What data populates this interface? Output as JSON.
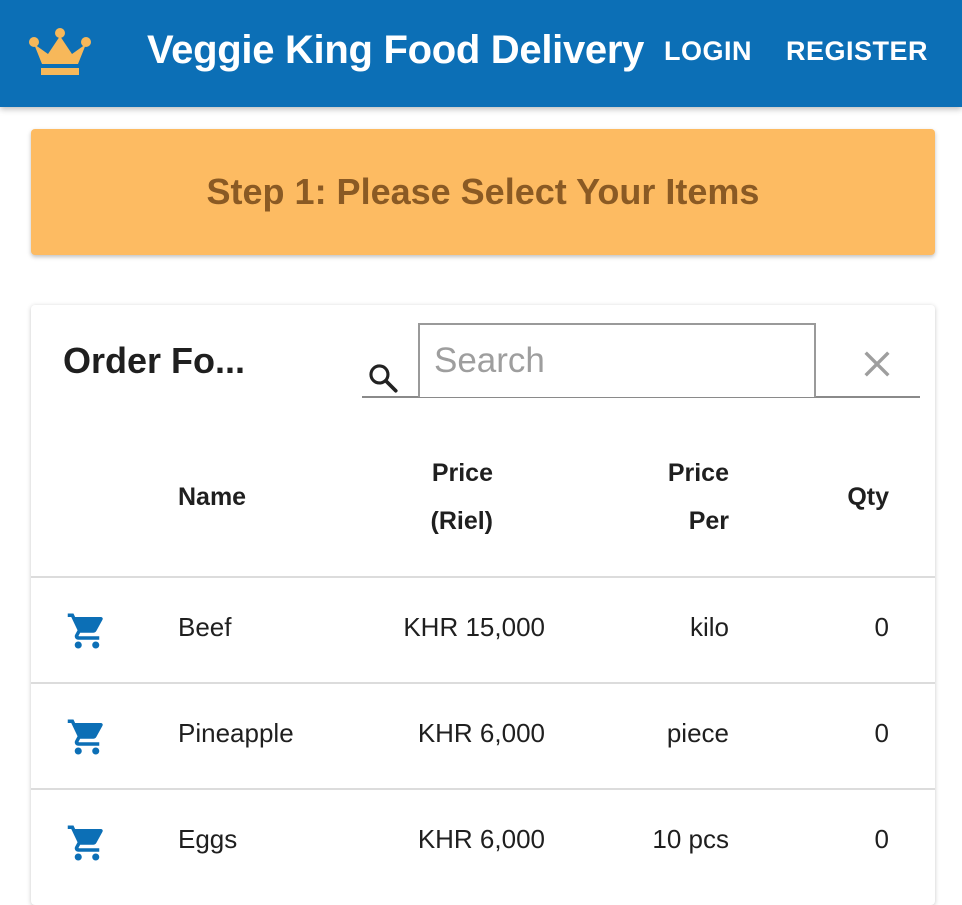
{
  "header": {
    "logo_icon": "crown-icon",
    "brand_color": "#0c6fb6",
    "logo_color": "#f7b85a",
    "title": "Veggie King Food Delivery",
    "login_label": "LOGIN",
    "register_label": "REGISTER"
  },
  "step_banner": {
    "text": "Step 1: Please Select Your Items",
    "background": "#fdbb62",
    "text_color": "#8a5a24"
  },
  "order_card": {
    "title": "Order Fo...",
    "search": {
      "placeholder": "Search",
      "value": "",
      "search_icon": "search-icon",
      "clear_icon": "close-icon"
    },
    "columns": {
      "name": "Name",
      "price_line1": "Price",
      "price_line2": "(Riel)",
      "per_line1": "Price",
      "per_line2": "Per",
      "qty": "Qty"
    },
    "row_icon": "cart-icon",
    "rows": [
      {
        "name": "Beef",
        "price": "KHR 15,000",
        "per": "kilo",
        "qty": "0"
      },
      {
        "name": "Pineapple",
        "price": "KHR 6,000",
        "per": "piece",
        "qty": "0"
      },
      {
        "name": "Eggs",
        "price": "KHR 6,000",
        "per": "10 pcs",
        "qty": "0"
      }
    ]
  }
}
